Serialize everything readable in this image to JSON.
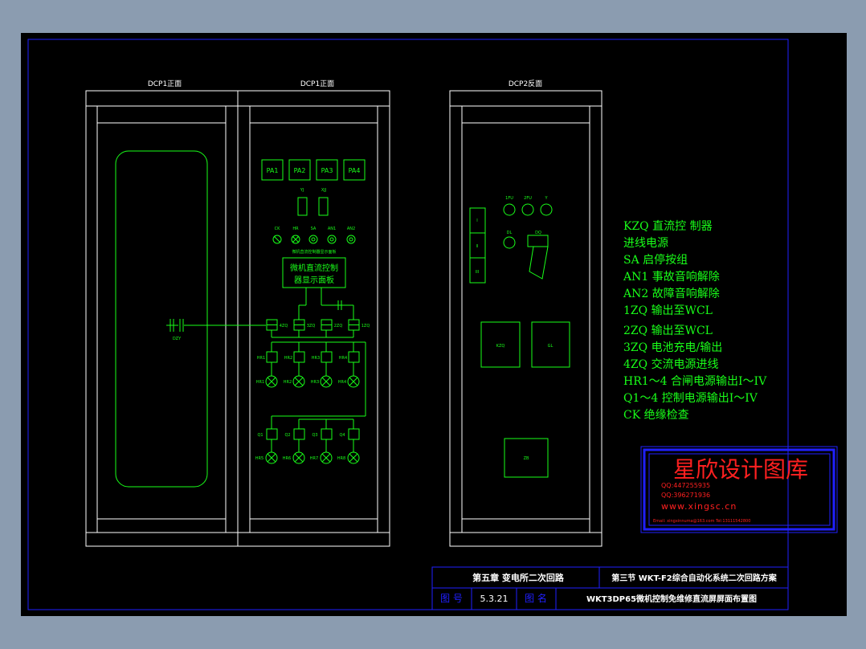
{
  "panels": {
    "dcp1_front_left": "DCP1正面",
    "dcp1_front_right": "DCP1正面",
    "dcp2_back": "DCP2反面"
  },
  "meters": [
    "PA1",
    "PA2",
    "PA3",
    "PA4"
  ],
  "relays": [
    "YJ",
    "XJJ"
  ],
  "switches": [
    "CK",
    "HR",
    "SA",
    "AN1",
    "AN2"
  ],
  "switch_caption": "微机直流控制器显示面板",
  "display_label": [
    "微机直流控制",
    "器显示面板"
  ],
  "dzy_label": "DZY",
  "breakers_top": [
    "4ZQ",
    "3ZQ",
    "2ZQ",
    "1ZQ",
    "KZQ"
  ],
  "breakers_mid": [
    "HR1",
    "HR2",
    "HR3",
    "HR4"
  ],
  "lamps_mid": [
    "HR1",
    "HR2",
    "HR3",
    "HR4"
  ],
  "breakers_bot": [
    "Q1",
    "Q2",
    "Q3",
    "Q4"
  ],
  "lamps_bot": [
    "HR5",
    "HR6",
    "HR7",
    "HR8"
  ],
  "back_rows": [
    "I",
    "II",
    "III"
  ],
  "back_fuses": [
    "1FU",
    "2FU",
    "Y"
  ],
  "back_dl": "DL",
  "back_dq": "DQ",
  "back_boxes": [
    "KZQ",
    "GL",
    "ZB"
  ],
  "legend": [
    "KZQ 直流控  制器",
    "进线电源",
    "SA  启停按组",
    "AN1 事故音响解除",
    "AN2 故障音响解除",
    "1ZQ 输出至WCL",
    "2ZQ     输出至WCL",
    "3ZQ     电池充电/输出",
    "4ZQ    交流电源进线",
    "HR1～4 合闸电源输出I～IV",
    "Q1～4  控制电源输出I～IV",
    "CK      绝缘检查"
  ],
  "watermark": {
    "title": "星欣设计图库",
    "qq1": "QQ:447255935",
    "qq2": "QQ:396271936",
    "url": "www.xingsc.cn",
    "email": "Email: xingxinnuma@163.com  Tel:13111542800"
  },
  "title_block": {
    "chapter": "第五章  变电所二次回路",
    "section": "第三节  WKT-F2综合自动化系统二次回路方案",
    "fig_no_label": "图 号",
    "fig_no": "5.3.21",
    "fig_name_label": "图 名",
    "fig_name": "WKT3DP65微机控制免维修直流屏屏面布置图"
  },
  "colors": {
    "background": "#8b9cb0",
    "sheet": "#000000",
    "line": "#ffffff",
    "element": "#19ff19",
    "border": "#2020ff",
    "watermark": "#ff2020"
  }
}
